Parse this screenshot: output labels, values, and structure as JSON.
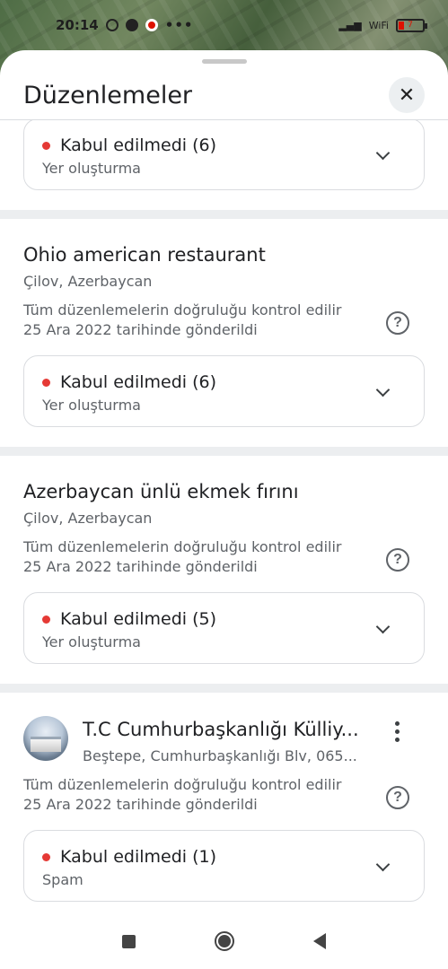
{
  "status_bar": {
    "time": "20:14",
    "dots": "•••",
    "battery": "7",
    "wifi_label": "WiFi"
  },
  "sheet": {
    "title": "Düzenlemeler",
    "close_icon": "close-icon"
  },
  "edits": [
    {
      "status": "Kabul edilmedi (6)",
      "type": "Yer oluşturma"
    },
    {
      "name": "Ohio american restaurant",
      "location": "Çilov, Azerbaycan",
      "info_line1": "Tüm düzenlemelerin doğruluğu kontrol edilir",
      "info_line2": "25 Ara 2022 tarihinde gönderildi",
      "status": "Kabul edilmedi (6)",
      "type": "Yer oluşturma"
    },
    {
      "name": "Azerbaycan ünlü ekmek fırını",
      "location": "Çilov, Azerbaycan",
      "info_line1": "Tüm düzenlemelerin doğruluğu kontrol edilir",
      "info_line2": "25 Ara 2022 tarihinde gönderildi",
      "status": "Kabul edilmedi (5)",
      "type": "Yer oluşturma"
    },
    {
      "name": "T.C Cumhurbaşkanlığı Külliy...",
      "location": "Beştepe, Cumhurbaşkanlığı Blv, 065...",
      "info_line1": "Tüm düzenlemelerin doğruluğu kontrol edilir",
      "info_line2": "25 Ara 2022 tarihinde gönderildi",
      "status": "Kabul edilmedi (1)",
      "type": "Spam"
    }
  ],
  "colors": {
    "rejected_dot": "#e53935",
    "text_primary": "#202124",
    "text_secondary": "#5f6368"
  }
}
